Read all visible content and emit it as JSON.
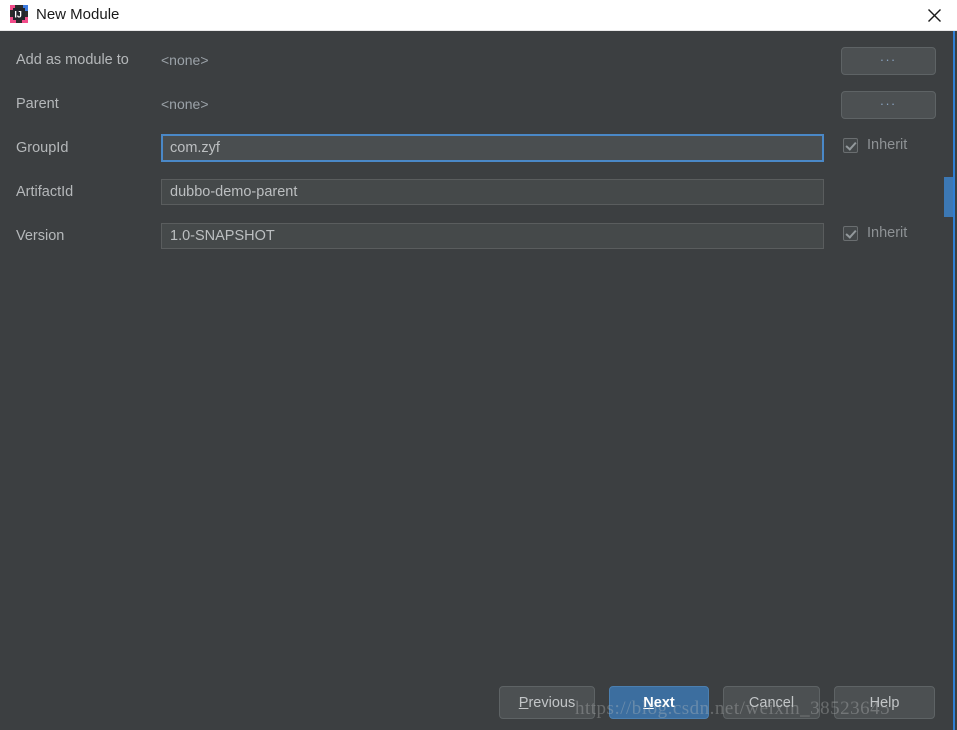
{
  "window": {
    "title": "New Module",
    "app_icon": "intellij-idea-icon",
    "close_icon": "close-icon",
    "titlebar_bg": "#ffffff",
    "body_bg": "#3c3f41",
    "accent_blue": "#4a88c7"
  },
  "form": {
    "rows": [
      {
        "label": "Add as module to",
        "kind": "plain",
        "value": "<none>",
        "browse_label": "...",
        "has_browse": true,
        "has_inherit": false
      },
      {
        "label": "Parent",
        "kind": "plain",
        "value": "<none>",
        "browse_label": "...",
        "has_browse": true,
        "has_inherit": false
      },
      {
        "label": "GroupId",
        "kind": "input",
        "value": "com.zyf",
        "focused": true,
        "has_browse": false,
        "has_inherit": true,
        "inherit_label": "Inherit",
        "inherit_checked": true
      },
      {
        "label": "ArtifactId",
        "kind": "input",
        "value": "dubbo-demo-parent",
        "focused": false,
        "has_browse": false,
        "has_inherit": false
      },
      {
        "label": "Version",
        "kind": "input",
        "value": "1.0-SNAPSHOT",
        "focused": false,
        "has_browse": false,
        "has_inherit": true,
        "inherit_label": "Inherit",
        "inherit_checked": true
      }
    ]
  },
  "buttons": {
    "previous": {
      "label": "Previous",
      "mnemonic": "P",
      "rest": "revious"
    },
    "next": {
      "label": "Next",
      "mnemonic": "N",
      "rest": "ext"
    },
    "cancel": {
      "label": "Cancel"
    },
    "help": {
      "label": "Help"
    }
  },
  "watermark": {
    "text": "https://blog.csdn.net/weixin_38523645"
  }
}
